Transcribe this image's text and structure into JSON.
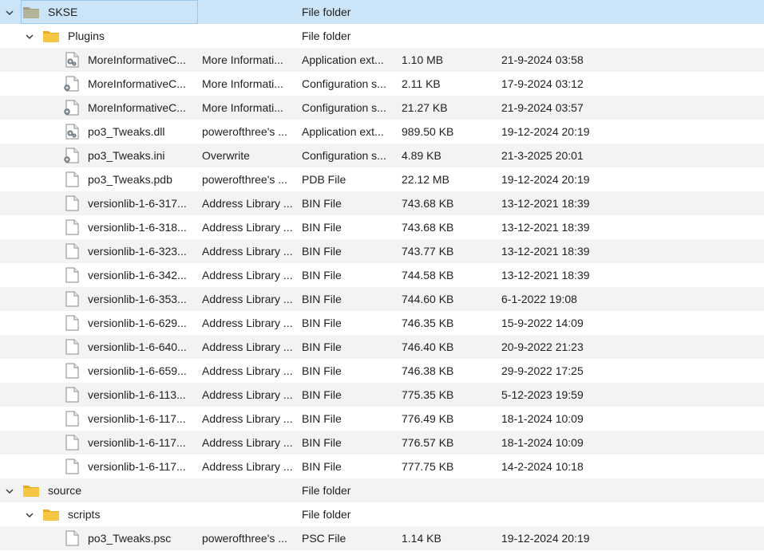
{
  "rows": [
    {
      "kind": "folder",
      "level": 0,
      "expanded": true,
      "selected": true,
      "alt": false,
      "icon": "folder-icon",
      "name": "SKSE",
      "desc": "",
      "type": "File folder",
      "size": "",
      "date": ""
    },
    {
      "kind": "folder",
      "level": 1,
      "expanded": true,
      "selected": false,
      "alt": false,
      "icon": "folder-icon",
      "name": "Plugins",
      "desc": "",
      "type": "File folder",
      "size": "",
      "date": ""
    },
    {
      "kind": "file",
      "level": 2,
      "alt": true,
      "icon": "dll-file-icon",
      "name": "MoreInformativeC...",
      "desc": "More Informati...",
      "type": "Application ext...",
      "size": "1.10 MB",
      "date": "21-9-2024 03:58"
    },
    {
      "kind": "file",
      "level": 2,
      "alt": false,
      "icon": "config-file-icon",
      "name": "MoreInformativeC...",
      "desc": "More Informati...",
      "type": "Configuration s...",
      "size": "2.11 KB",
      "date": "17-9-2024 03:12"
    },
    {
      "kind": "file",
      "level": 2,
      "alt": true,
      "icon": "config-file-icon",
      "name": "MoreInformativeC...",
      "desc": "More Informati...",
      "type": "Configuration s...",
      "size": "21.27 KB",
      "date": "21-9-2024 03:57"
    },
    {
      "kind": "file",
      "level": 2,
      "alt": false,
      "icon": "dll-file-icon",
      "name": "po3_Tweaks.dll",
      "desc": "powerofthree's ...",
      "type": "Application ext...",
      "size": "989.50 KB",
      "date": "19-12-2024 20:19"
    },
    {
      "kind": "file",
      "level": 2,
      "alt": true,
      "icon": "config-file-icon",
      "name": "po3_Tweaks.ini",
      "desc": "Overwrite",
      "type": "Configuration s...",
      "size": "4.89 KB",
      "date": "21-3-2025 20:01"
    },
    {
      "kind": "file",
      "level": 2,
      "alt": false,
      "icon": "generic-file-icon",
      "name": "po3_Tweaks.pdb",
      "desc": "powerofthree's ...",
      "type": "PDB File",
      "size": "22.12 MB",
      "date": "19-12-2024 20:19"
    },
    {
      "kind": "file",
      "level": 2,
      "alt": true,
      "icon": "generic-file-icon",
      "name": "versionlib-1-6-317...",
      "desc": "Address Library ...",
      "type": "BIN File",
      "size": "743.68 KB",
      "date": "13-12-2021 18:39"
    },
    {
      "kind": "file",
      "level": 2,
      "alt": false,
      "icon": "generic-file-icon",
      "name": "versionlib-1-6-318...",
      "desc": "Address Library ...",
      "type": "BIN File",
      "size": "743.68 KB",
      "date": "13-12-2021 18:39"
    },
    {
      "kind": "file",
      "level": 2,
      "alt": true,
      "icon": "generic-file-icon",
      "name": "versionlib-1-6-323...",
      "desc": "Address Library ...",
      "type": "BIN File",
      "size": "743.77 KB",
      "date": "13-12-2021 18:39"
    },
    {
      "kind": "file",
      "level": 2,
      "alt": false,
      "icon": "generic-file-icon",
      "name": "versionlib-1-6-342...",
      "desc": "Address Library ...",
      "type": "BIN File",
      "size": "744.58 KB",
      "date": "13-12-2021 18:39"
    },
    {
      "kind": "file",
      "level": 2,
      "alt": true,
      "icon": "generic-file-icon",
      "name": "versionlib-1-6-353...",
      "desc": "Address Library ...",
      "type": "BIN File",
      "size": "744.60 KB",
      "date": "6-1-2022 19:08"
    },
    {
      "kind": "file",
      "level": 2,
      "alt": false,
      "icon": "generic-file-icon",
      "name": "versionlib-1-6-629...",
      "desc": "Address Library ...",
      "type": "BIN File",
      "size": "746.35 KB",
      "date": "15-9-2022 14:09"
    },
    {
      "kind": "file",
      "level": 2,
      "alt": true,
      "icon": "generic-file-icon",
      "name": "versionlib-1-6-640...",
      "desc": "Address Library ...",
      "type": "BIN File",
      "size": "746.40 KB",
      "date": "20-9-2022 21:23"
    },
    {
      "kind": "file",
      "level": 2,
      "alt": false,
      "icon": "generic-file-icon",
      "name": "versionlib-1-6-659...",
      "desc": "Address Library ...",
      "type": "BIN File",
      "size": "746.38 KB",
      "date": "29-9-2022 17:25"
    },
    {
      "kind": "file",
      "level": 2,
      "alt": true,
      "icon": "generic-file-icon",
      "name": "versionlib-1-6-113...",
      "desc": "Address Library ...",
      "type": "BIN File",
      "size": "775.35 KB",
      "date": "5-12-2023 19:59"
    },
    {
      "kind": "file",
      "level": 2,
      "alt": false,
      "icon": "generic-file-icon",
      "name": "versionlib-1-6-117...",
      "desc": "Address Library ...",
      "type": "BIN File",
      "size": "776.49 KB",
      "date": "18-1-2024 10:09"
    },
    {
      "kind": "file",
      "level": 2,
      "alt": true,
      "icon": "generic-file-icon",
      "name": "versionlib-1-6-117...",
      "desc": "Address Library ...",
      "type": "BIN File",
      "size": "776.57 KB",
      "date": "18-1-2024 10:09"
    },
    {
      "kind": "file",
      "level": 2,
      "alt": false,
      "icon": "generic-file-icon",
      "name": "versionlib-1-6-117...",
      "desc": "Address Library ...",
      "type": "BIN File",
      "size": "777.75 KB",
      "date": "14-2-2024 10:18"
    },
    {
      "kind": "folder",
      "level": 0,
      "expanded": true,
      "selected": false,
      "alt": true,
      "icon": "folder-icon",
      "name": "source",
      "desc": "",
      "type": "File folder",
      "size": "",
      "date": ""
    },
    {
      "kind": "folder",
      "level": 1,
      "expanded": true,
      "selected": false,
      "alt": false,
      "icon": "folder-icon",
      "name": "scripts",
      "desc": "",
      "type": "File folder",
      "size": "",
      "date": ""
    },
    {
      "kind": "file",
      "level": 2,
      "alt": true,
      "icon": "generic-file-icon",
      "name": "po3_Tweaks.psc",
      "desc": "powerofthree's ...",
      "type": "PSC File",
      "size": "1.14 KB",
      "date": "19-12-2024 20:19"
    }
  ]
}
